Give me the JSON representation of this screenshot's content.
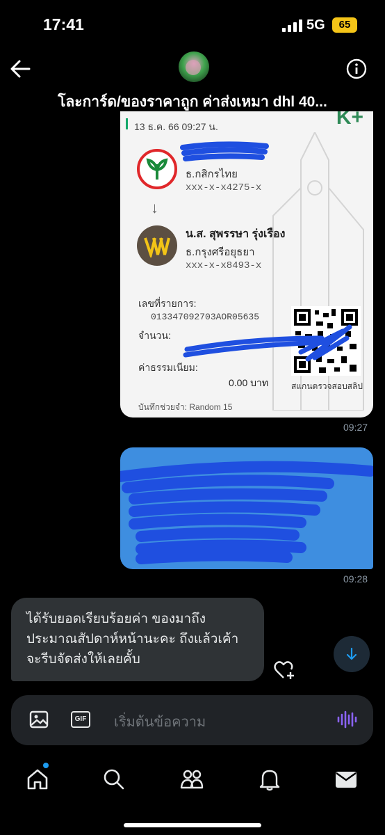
{
  "status_bar": {
    "time": "17:41",
    "network": "5G",
    "battery": "65"
  },
  "header": {
    "title": "โละการ์ด/ของราคาถูก ค่าส่งเหมา dhl 40..."
  },
  "slip": {
    "date_time": "13 ธ.ค. 66  09:27 น.",
    "brand": "K+",
    "sender_bank": "ธ.กสิกรไทย",
    "sender_account": "xxx-x-x4275-x",
    "receiver_name": "น.ส. สุพรรษา รุ่งเรือง",
    "receiver_bank": "ธ.กรุงศรีอยุธยา",
    "receiver_account": "xxx-x-x8493-x",
    "ref_label": "เลขที่รายการ:",
    "ref_value": "013347092703AOR05635",
    "amount_label": "จำนวน:",
    "fee_label": "ค่าธรรมเนียม:",
    "fee_value": "0.00 บาท",
    "qr_caption": "สแกนตรวจสอบสลิป",
    "memo": "บันทึกช่วยจำ: Random 15"
  },
  "messages": {
    "slip_time": "09:27",
    "blue_time": "09:28",
    "received_text": "ได้รับยอดเรียบร้อยค่า ของมาถึงประมาณสัปดาห์หน้านะคะ ถึงแล้วเค้าจะรีบจัดส่งให้เลยคั้บ"
  },
  "composer": {
    "gif_label": "GIF",
    "placeholder": "เริ่มต้นข้อความ"
  },
  "colors": {
    "accent": "#1d9bf0",
    "sent_bubble": "#3e8ee0",
    "received_bubble": "#2f3336",
    "scribble": "#1f4fe0"
  }
}
